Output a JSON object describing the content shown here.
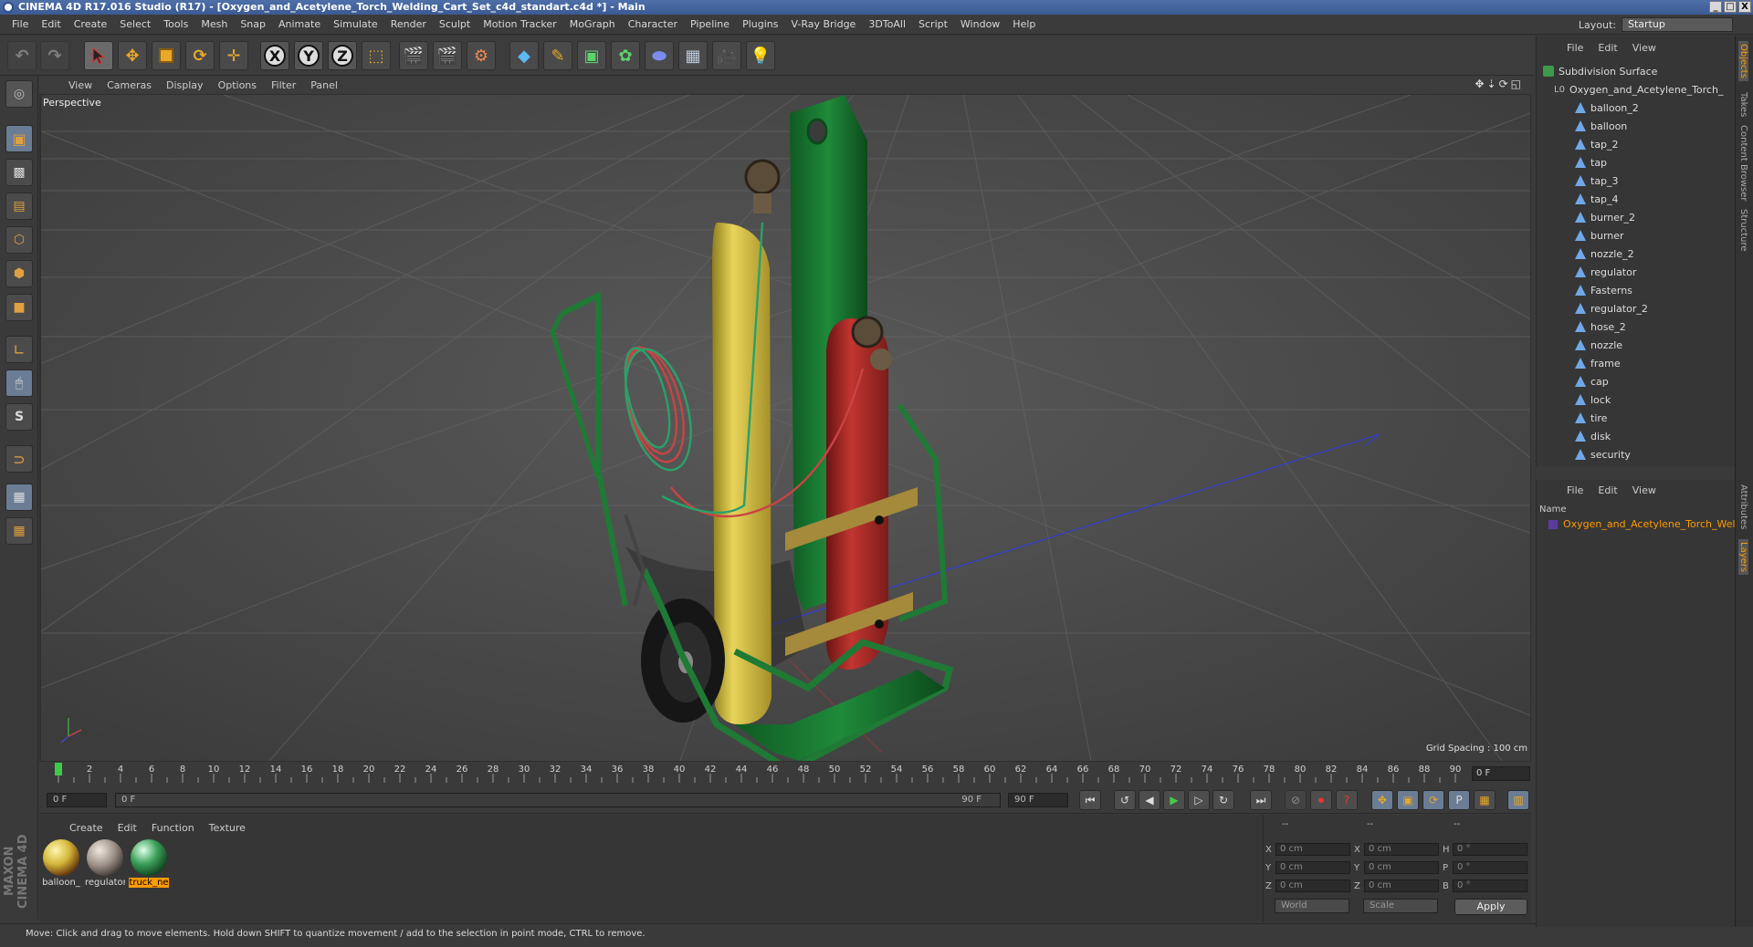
{
  "titlebar": {
    "title": "CINEMA 4D R17.016 Studio (R17) - [Oxygen_and_Acetylene_Torch_Welding_Cart_Set_c4d_standart.c4d *] - Main",
    "buttons": [
      "_",
      "□",
      "X"
    ]
  },
  "menu": [
    "File",
    "Edit",
    "Create",
    "Select",
    "Tools",
    "Mesh",
    "Snap",
    "Animate",
    "Simulate",
    "Render",
    "Sculpt",
    "Motion Tracker",
    "MoGraph",
    "Character",
    "Pipeline",
    "Plugins",
    "V-Ray Bridge",
    "3DToAll",
    "Script",
    "Window",
    "Help"
  ],
  "layout": {
    "label": "Layout:",
    "value": "Startup"
  },
  "toolbar": {
    "x_axis": "X",
    "y_axis": "Y",
    "z_axis": "Z"
  },
  "viewport": {
    "menu": [
      "View",
      "Cameras",
      "Display",
      "Options",
      "Filter",
      "Panel"
    ],
    "icons": "✥⇣⟳◱",
    "camera": "Perspective",
    "grid_spacing": "Grid Spacing : 100 cm"
  },
  "timeline": {
    "ticks": [
      "0",
      "2",
      "4",
      "6",
      "8",
      "10",
      "12",
      "14",
      "16",
      "18",
      "20",
      "22",
      "24",
      "26",
      "28",
      "30",
      "32",
      "34",
      "36",
      "38",
      "40",
      "42",
      "44",
      "46",
      "48",
      "50",
      "52",
      "54",
      "56",
      "58",
      "60",
      "62",
      "64",
      "66",
      "68",
      "70",
      "72",
      "74",
      "76",
      "78",
      "80",
      "82",
      "84",
      "86",
      "88",
      "90"
    ],
    "current_frame": "0 F"
  },
  "transport": {
    "start": "0 F",
    "range_start": "0 F",
    "range_end": "90 F",
    "end": "90 F"
  },
  "materials": {
    "menu": [
      "Create",
      "Edit",
      "Function",
      "Texture"
    ],
    "items": [
      {
        "name": "balloon_"
      },
      {
        "name": "regulator"
      },
      {
        "name": "truck_ne"
      }
    ],
    "logo": "MAXON CINEMA 4D"
  },
  "coords": {
    "headers": [
      "--",
      "--",
      "--"
    ],
    "rows": [
      [
        "X",
        "0 cm",
        "X",
        "0 cm",
        "H",
        "0 °"
      ],
      [
        "Y",
        "0 cm",
        "Y",
        "0 cm",
        "P",
        "0 °"
      ],
      [
        "Z",
        "0 cm",
        "Z",
        "0 cm",
        "B",
        "0 °"
      ]
    ],
    "mode1": "World",
    "mode2": "Scale",
    "apply": "Apply"
  },
  "status": "Move: Click and drag to move elements. Hold down SHIFT to quantize movement / add to the selection in point mode, CTRL to remove.",
  "objects": {
    "menu": [
      "File",
      "Edit",
      "View"
    ],
    "root": "Subdivision Surface",
    "group": "Oxygen_and_Acetylene_Torch_",
    "items": [
      "balloon_2",
      "balloon",
      "tap_2",
      "tap",
      "tap_3",
      "tap_4",
      "burner_2",
      "burner",
      "nozzle_2",
      "regulator",
      "Fasterns",
      "regulator_2",
      "hose_2",
      "nozzle",
      "frame",
      "cap",
      "lock",
      "tire",
      "disk",
      "security"
    ]
  },
  "layers": {
    "menu": [
      "File",
      "Edit",
      "View"
    ],
    "header": "Name",
    "item": "Oxygen_and_Acetylene_Torch_Wel"
  },
  "sidetabs": [
    "Objects",
    "Takes",
    "Content Browser",
    "Structure",
    "Attributes",
    "Layers"
  ],
  "colors": {
    "accent": "#ff9a00",
    "title": "#3b5a93",
    "cart_green": "#1f7a35",
    "oxygen_yellow": "#d6c240",
    "acetylene_red": "#b02a28"
  }
}
